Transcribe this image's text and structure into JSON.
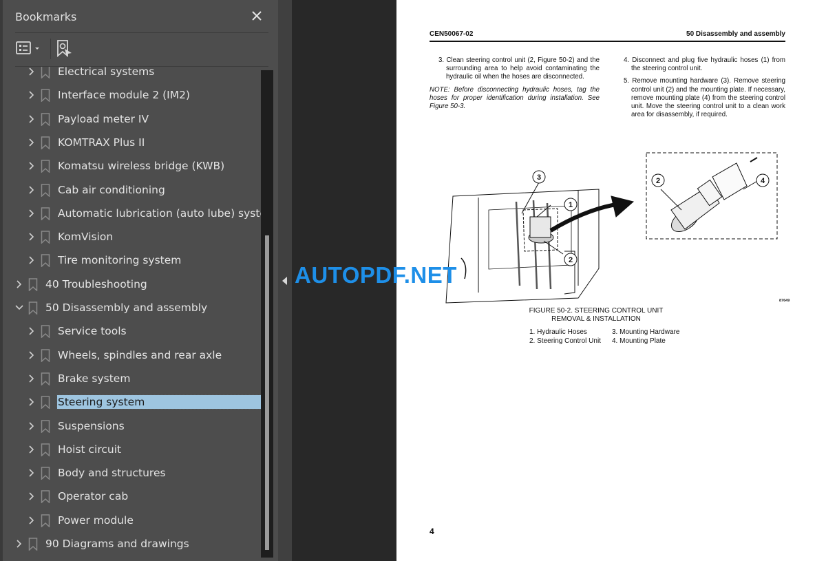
{
  "sidebar": {
    "title": "Bookmarks",
    "close_icon": "close-icon",
    "toolbar": {
      "options_icon": "list-options-icon",
      "find_icon": "find-bookmark-icon"
    },
    "items": [
      {
        "label": "Electrical systems",
        "level": 2,
        "expanded": false,
        "selected": false
      },
      {
        "label": "Interface module 2 (IM2)",
        "level": 2,
        "expanded": false,
        "selected": false
      },
      {
        "label": "Payload meter IV",
        "level": 2,
        "expanded": false,
        "selected": false
      },
      {
        "label": "KOMTRAX Plus II",
        "level": 2,
        "expanded": false,
        "selected": false
      },
      {
        "label": "Komatsu wireless bridge (KWB)",
        "level": 2,
        "expanded": false,
        "selected": false
      },
      {
        "label": "Cab air conditioning",
        "level": 2,
        "expanded": false,
        "selected": false
      },
      {
        "label": "Automatic lubrication (auto lube) system",
        "level": 2,
        "expanded": false,
        "selected": false
      },
      {
        "label": "KomVision",
        "level": 2,
        "expanded": false,
        "selected": false
      },
      {
        "label": "Tire monitoring system",
        "level": 2,
        "expanded": false,
        "selected": false
      },
      {
        "label": "40 Troubleshooting",
        "level": 1,
        "expanded": false,
        "selected": false
      },
      {
        "label": "50 Disassembly and assembly",
        "level": 1,
        "expanded": true,
        "selected": false
      },
      {
        "label": "Service tools",
        "level": 2,
        "expanded": false,
        "selected": false
      },
      {
        "label": "Wheels, spindles and rear axle",
        "level": 2,
        "expanded": false,
        "selected": false
      },
      {
        "label": "Brake system",
        "level": 2,
        "expanded": false,
        "selected": false
      },
      {
        "label": "Steering system",
        "level": 2,
        "expanded": false,
        "selected": true
      },
      {
        "label": "Suspensions",
        "level": 2,
        "expanded": false,
        "selected": false
      },
      {
        "label": "Hoist circuit",
        "level": 2,
        "expanded": false,
        "selected": false
      },
      {
        "label": "Body and structures",
        "level": 2,
        "expanded": false,
        "selected": false
      },
      {
        "label": "Operator cab",
        "level": 2,
        "expanded": false,
        "selected": false
      },
      {
        "label": "Power module",
        "level": 2,
        "expanded": false,
        "selected": false
      },
      {
        "label": "90 Diagrams and drawings",
        "level": 1,
        "expanded": false,
        "selected": false
      }
    ]
  },
  "document": {
    "header_left": "CEN50067-02",
    "header_right": "50 Disassembly and assembly",
    "left_column": {
      "step3": "3. Clean steering control unit (2, Figure 50-2) and the surrounding area to help avoid contaminating the hydraulic oil when the hoses are disconnected.",
      "note": "NOTE: Before disconnecting hydraulic hoses, tag the hoses for proper identification during installation. See Figure 50-3."
    },
    "right_column": {
      "step4": "4. Disconnect and plug five hydraulic hoses (1) from the steering control unit.",
      "step5": "5. Remove mounting hardware (3). Remove steering control unit (2) and the mounting plate. If necessary, remove mounting plate (4) from the steering control unit. Move the steering control unit to a clean work area for disassembly, if required."
    },
    "figure": {
      "callouts": [
        "1",
        "2",
        "3",
        "2",
        "4"
      ],
      "figure_id": "87649",
      "caption_line1": "FIGURE 50-2. STEERING CONTROL UNIT",
      "caption_line2": "REMOVAL & INSTALLATION",
      "legend": [
        "1. Hydraulic Hoses",
        "3. Mounting Hardware",
        "2. Steering Control Unit",
        "4. Mounting Plate"
      ]
    },
    "page_number": "4"
  },
  "watermark": "AUTOPDF.NET"
}
